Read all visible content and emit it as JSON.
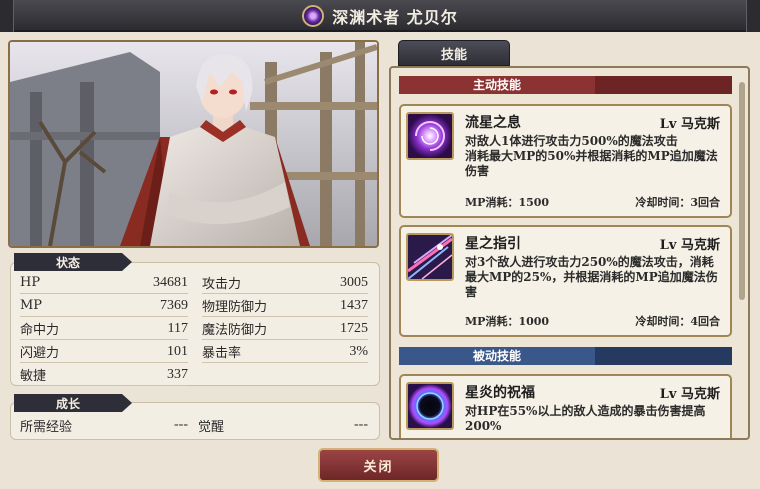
{
  "window": {
    "title": "深渊术者 尤贝尔",
    "title_icon": "vortex-emblem-icon"
  },
  "status": {
    "section_label": "状态",
    "left_stats": [
      {
        "label": "HP",
        "value": "34681"
      },
      {
        "label": "MP",
        "value": "7369"
      },
      {
        "label": "命中力",
        "value": "117"
      },
      {
        "label": "闪避力",
        "value": "101"
      },
      {
        "label": "敏捷",
        "value": "337"
      }
    ],
    "right_stats": [
      {
        "label": "攻击力",
        "value": "3005"
      },
      {
        "label": "物理防御力",
        "value": "1437"
      },
      {
        "label": "魔法防御力",
        "value": "1725"
      },
      {
        "label": "暴击率",
        "value": "3%"
      }
    ]
  },
  "growth": {
    "section_label": "成长",
    "exp_label": "所需经验",
    "exp_value": "---",
    "awaken_label": "觉醒",
    "awaken_value": "---"
  },
  "skills": {
    "tab_label": "技能",
    "active_category": "主动技能",
    "passive_category": "被动技能",
    "items": [
      {
        "name": "流星之息",
        "level": "Lv 马克斯",
        "desc": "对敌人1体进行攻击力500%的魔法攻击\n消耗最大MP的50%并根据消耗的MP追加魔法伤害",
        "mp_cost": "MP消耗：1500",
        "cooldown": "冷却时间：3回合",
        "icon": "purple-vortex-icon"
      },
      {
        "name": "星之指引",
        "level": "Lv 马克斯",
        "desc": "对3个敌人进行攻击力250%的魔法攻击，消耗最大MP的25%，并根据消耗的MP追加魔法伤害",
        "mp_cost": "MP消耗：1000",
        "cooldown": "冷却时间：4回合",
        "icon": "star-streak-icon"
      },
      {
        "name": "星炎的祝福",
        "level": "Lv 马克斯",
        "desc": "对HP在55%以上的敌人造成的暴击伤害提高200%",
        "icon": "blue-black-hole-icon"
      }
    ]
  },
  "close_label": "关闭",
  "colors": {
    "active_category": "#8b3333",
    "passive_category": "#3a578a",
    "close_button": "#8a3535"
  }
}
